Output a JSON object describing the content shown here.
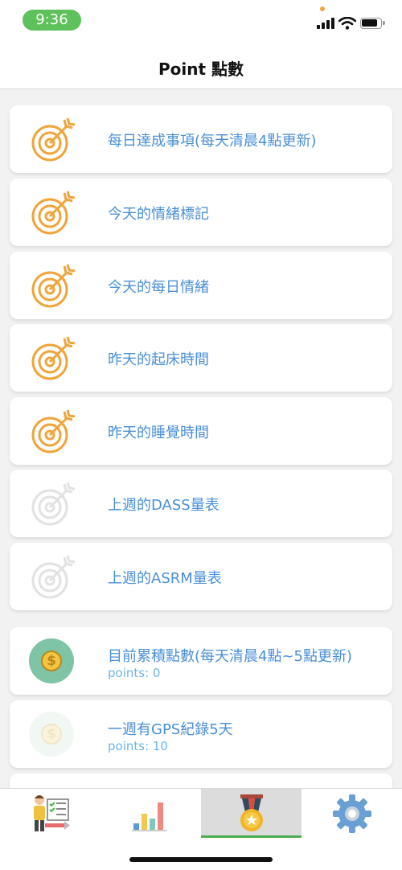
{
  "status": {
    "time": "9:36"
  },
  "header": {
    "title": "Point 點數"
  },
  "tasks": [
    {
      "label": "每日達成事項(每天清晨4點更新)",
      "icon": "target-icon",
      "state": "active"
    },
    {
      "label": "今天的情緒標記",
      "icon": "target-icon",
      "state": "active"
    },
    {
      "label": "今天的每日情緒",
      "icon": "target-icon",
      "state": "active"
    },
    {
      "label": "昨天的起床時間",
      "icon": "target-icon",
      "state": "active"
    },
    {
      "label": "昨天的睡覺時間",
      "icon": "target-icon",
      "state": "active"
    },
    {
      "label": "上週的DASS量表",
      "icon": "target-icon",
      "state": "inactive"
    },
    {
      "label": "上週的ASRM量表",
      "icon": "target-icon",
      "state": "inactive"
    }
  ],
  "rewards": [
    {
      "label": "目前累積點數(每天清晨4點~5點更新)",
      "points": "points: 0",
      "icon": "coin-icon",
      "state": "active"
    },
    {
      "label": "一週有GPS紀錄5天",
      "points": "points: 10",
      "icon": "coin-icon",
      "state": "inactive"
    }
  ],
  "tabs": [
    {
      "name": "tasks-tab",
      "icon": "person-checklist-icon",
      "active": false
    },
    {
      "name": "chart-tab",
      "icon": "bar-chart-icon",
      "active": false
    },
    {
      "name": "points-tab",
      "icon": "medal-icon",
      "active": true
    },
    {
      "name": "settings-tab",
      "icon": "gear-icon",
      "active": false
    }
  ],
  "colors": {
    "accent_orange": "#f0a43a",
    "label_blue": "#4a8fd8",
    "points_blue": "#6cb6e8",
    "coin_green": "#7fc4a4",
    "tab_active_bar": "#4caf50"
  }
}
